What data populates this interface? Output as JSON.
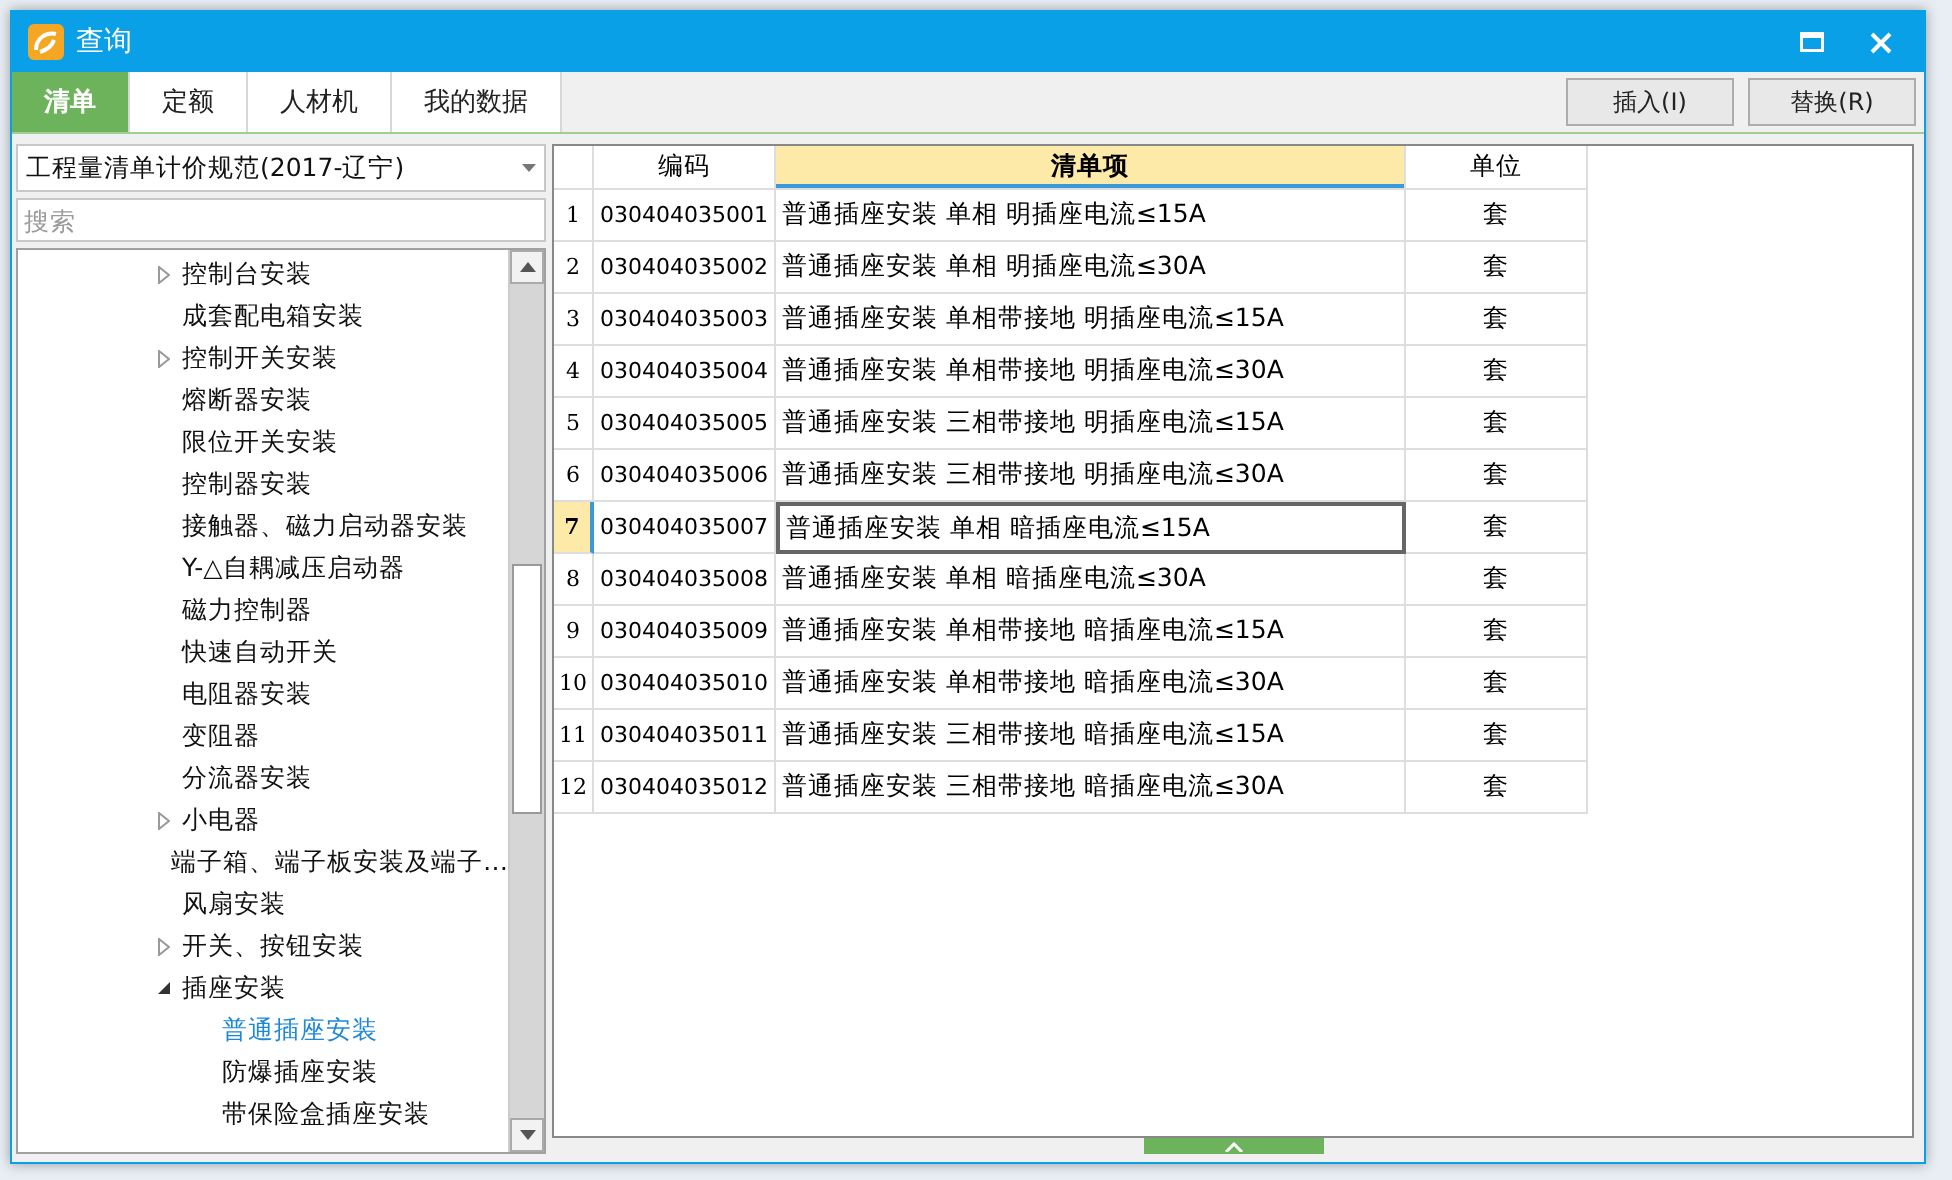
{
  "window": {
    "title": "查询"
  },
  "tabs": [
    {
      "label": "清单",
      "selected": true
    },
    {
      "label": "定额",
      "selected": false
    },
    {
      "label": "人材机",
      "selected": false
    },
    {
      "label": "我的数据",
      "selected": false
    }
  ],
  "buttons": [
    "插入(I)",
    "替换(R)"
  ],
  "spec_select": {
    "value": "工程量清单计价规范(2017-辽宁)"
  },
  "search": {
    "placeholder": "搜索"
  },
  "tree": [
    {
      "label": "控制台安装",
      "kind": "folder",
      "expanded": false,
      "selected": false
    },
    {
      "label": "成套配电箱安装",
      "kind": "leaf",
      "selected": false
    },
    {
      "label": "控制开关安装",
      "kind": "folder",
      "expanded": false,
      "selected": false
    },
    {
      "label": "熔断器安装",
      "kind": "leaf",
      "selected": false
    },
    {
      "label": "限位开关安装",
      "kind": "leaf",
      "selected": false
    },
    {
      "label": "控制器安装",
      "kind": "leaf",
      "selected": false
    },
    {
      "label": "接触器、磁力启动器安装",
      "kind": "leaf",
      "selected": false
    },
    {
      "label": "Y-△自耦减压启动器",
      "kind": "leaf",
      "selected": false
    },
    {
      "label": "磁力控制器",
      "kind": "leaf",
      "selected": false
    },
    {
      "label": "快速自动开关",
      "kind": "leaf",
      "selected": false
    },
    {
      "label": "电阻器安装",
      "kind": "leaf",
      "selected": false
    },
    {
      "label": "变阻器",
      "kind": "leaf",
      "selected": false
    },
    {
      "label": "分流器安装",
      "kind": "leaf",
      "selected": false
    },
    {
      "label": "小电器",
      "kind": "folder",
      "expanded": false,
      "selected": false
    },
    {
      "label": "端子箱、端子板安装及端子…",
      "kind": "leaf",
      "selected": false
    },
    {
      "label": "风扇安装",
      "kind": "leaf",
      "selected": false
    },
    {
      "label": "开关、按钮安装",
      "kind": "folder",
      "expanded": false,
      "selected": false
    },
    {
      "label": "插座安装",
      "kind": "folder",
      "expanded": true,
      "selected": false,
      "children": [
        {
          "label": "普通插座安装",
          "selected": true
        },
        {
          "label": "防爆插座安装",
          "selected": false
        },
        {
          "label": "带保险盒插座安装",
          "selected": false
        }
      ]
    }
  ],
  "table": {
    "columns": [
      {
        "label": "编码",
        "selected": false
      },
      {
        "label": "清单项",
        "selected": true
      },
      {
        "label": "单位",
        "selected": false
      }
    ],
    "rows": [
      {
        "number": "1",
        "code": "030404035001",
        "item": "普通插座安装 单相 明插座电流≤15A",
        "unit": "套",
        "selected": false
      },
      {
        "number": "2",
        "code": "030404035002",
        "item": "普通插座安装 单相 明插座电流≤30A",
        "unit": "套",
        "selected": false
      },
      {
        "number": "3",
        "code": "030404035003",
        "item": "普通插座安装 单相带接地 明插座电流≤15A",
        "unit": "套",
        "selected": false
      },
      {
        "number": "4",
        "code": "030404035004",
        "item": "普通插座安装 单相带接地 明插座电流≤30A",
        "unit": "套",
        "selected": false
      },
      {
        "number": "5",
        "code": "030404035005",
        "item": "普通插座安装 三相带接地 明插座电流≤15A",
        "unit": "套",
        "selected": false
      },
      {
        "number": "6",
        "code": "030404035006",
        "item": "普通插座安装 三相带接地 明插座电流≤30A",
        "unit": "套",
        "selected": false
      },
      {
        "number": "7",
        "code": "030404035007",
        "item": "普通插座安装 单相 暗插座电流≤15A",
        "unit": "套",
        "selected": true
      },
      {
        "number": "8",
        "code": "030404035008",
        "item": "普通插座安装 单相 暗插座电流≤30A",
        "unit": "套",
        "selected": false
      },
      {
        "number": "9",
        "code": "030404035009",
        "item": "普通插座安装 单相带接地 暗插座电流≤15A",
        "unit": "套",
        "selected": false
      },
      {
        "number": "10",
        "code": "030404035010",
        "item": "普通插座安装 单相带接地 暗插座电流≤30A",
        "unit": "套",
        "selected": false
      },
      {
        "number": "11",
        "code": "030404035011",
        "item": "普通插座安装 三相带接地 暗插座电流≤15A",
        "unit": "套",
        "selected": false
      },
      {
        "number": "12",
        "code": "030404035012",
        "item": "普通插座安装 三相带接地 暗插座电流≤30A",
        "unit": "套",
        "selected": false
      }
    ]
  }
}
